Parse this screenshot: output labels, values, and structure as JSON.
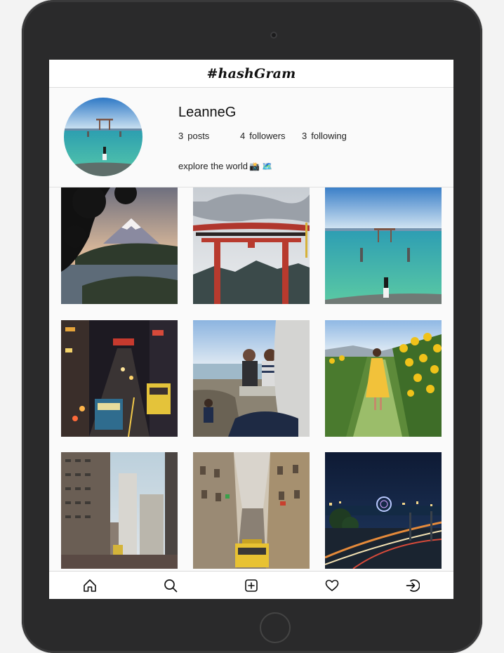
{
  "app": {
    "logo": "#hashGram"
  },
  "profile": {
    "username": "LeanneG",
    "posts_count": "3",
    "posts_label": "posts",
    "followers_count": "4",
    "followers_label": "followers",
    "following_count": "3",
    "following_label": "following",
    "bio": "explore the world",
    "bio_emoji": "📸 🗺️"
  },
  "grid": {
    "photos": [
      {
        "subject": "mount-fuji-lake"
      },
      {
        "subject": "red-torii-gate"
      },
      {
        "subject": "lake-torii-woman"
      },
      {
        "subject": "hong-kong-trams-night"
      },
      {
        "subject": "couple-on-beach-rocks"
      },
      {
        "subject": "woman-sunflower-field"
      },
      {
        "subject": "hong-kong-towers"
      },
      {
        "subject": "lisbon-tram-street"
      },
      {
        "subject": "city-night-ferris-wheel"
      }
    ]
  },
  "nav": {
    "items": [
      {
        "icon": "home-icon"
      },
      {
        "icon": "search-icon"
      },
      {
        "icon": "add-post-icon"
      },
      {
        "icon": "heart-icon"
      },
      {
        "icon": "logout-icon"
      }
    ]
  }
}
